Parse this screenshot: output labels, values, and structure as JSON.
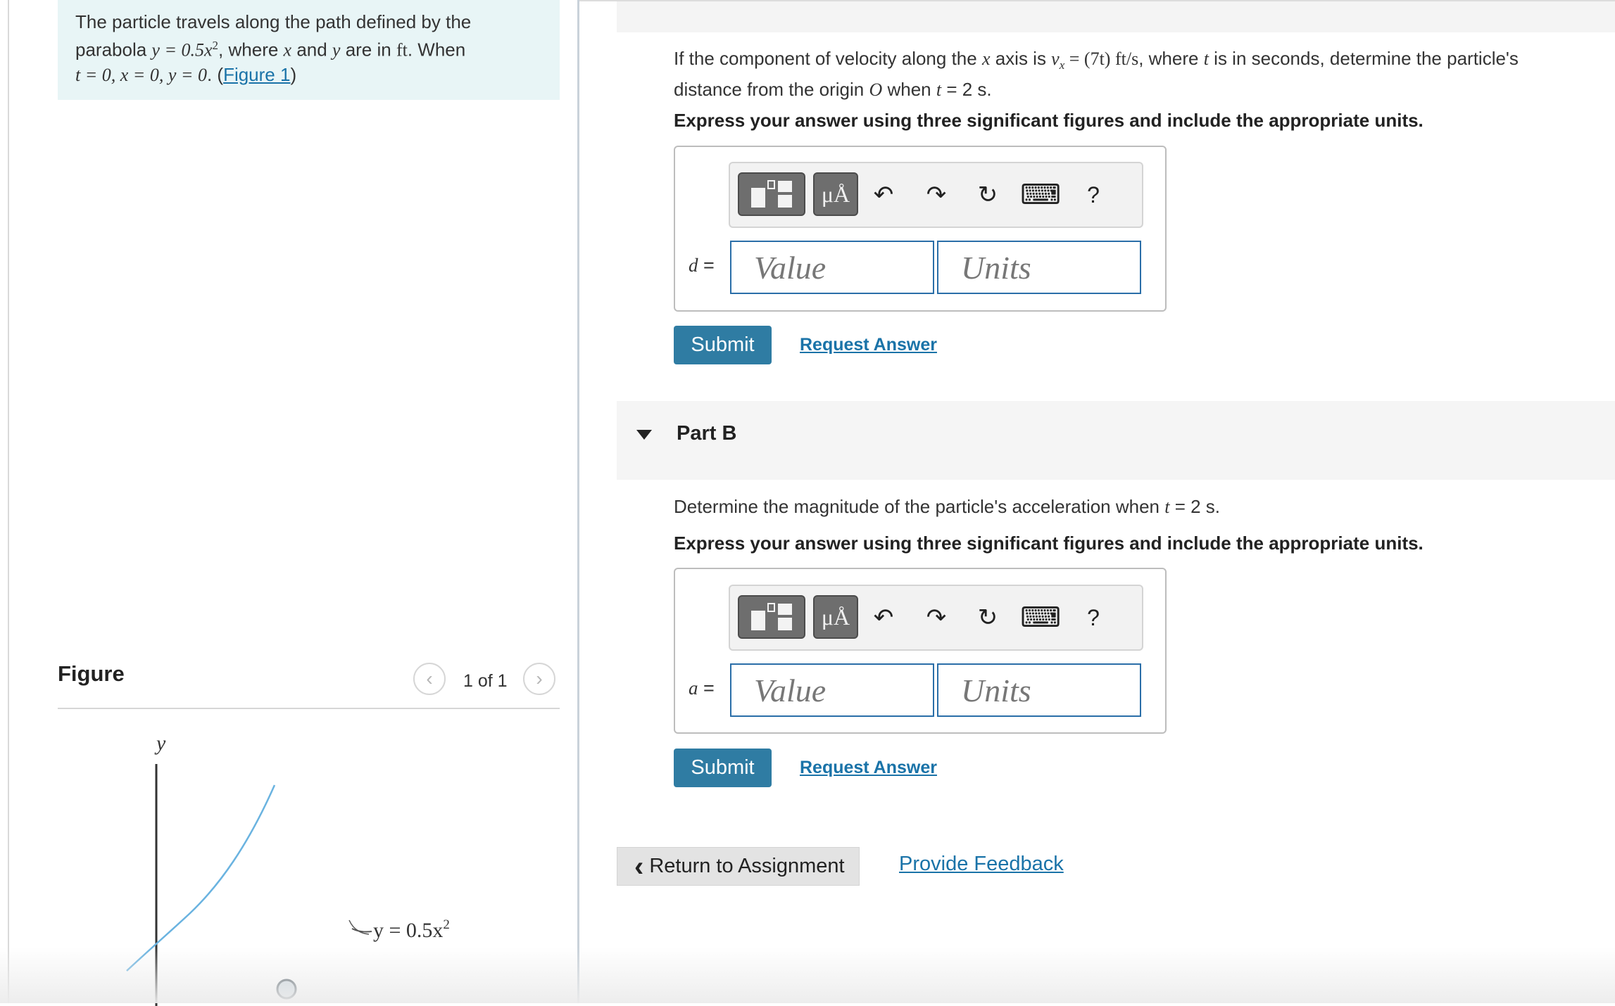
{
  "intro": {
    "line1": "The particle travels along the path defined by the",
    "line2_a": "parabola ",
    "line2_eq": "y = 0.5x",
    "line2_sup": "2",
    "line2_b": ", where ",
    "line2_x": "x",
    "line2_c": " and ",
    "line2_y": "y",
    "line2_d": " are in ",
    "line2_unit": "ft",
    "line2_e": ". When",
    "line3_eq": "t = 0, x = 0, y = 0",
    "line3_a": ". (",
    "figure_link": "Figure 1",
    "line3_b": ")"
  },
  "figure": {
    "title": "Figure",
    "counter": "1 of 1",
    "prev_glyph": "‹",
    "next_glyph": "›",
    "axis_y_label": "y",
    "curve_label": "y = 0.5x",
    "curve_label_sup": "2"
  },
  "partA": {
    "q_a": "If the component of velocity along the ",
    "q_x": "x",
    "q_b": " axis is ",
    "q_vx": "v",
    "q_vx_sub": "x",
    "q_c": " = (7t)  ft/s",
    "q_d": ", where ",
    "q_t": "t",
    "q_e": " is in seconds, determine the particle's",
    "q_line2_a": "distance from the origin ",
    "q_O": "O",
    "q_line2_b": " when ",
    "q_t2": "t",
    "q_line2_c": " = 2 s.",
    "instruction": "Express your answer using three significant figures and include the appropriate units.",
    "var": "d",
    "var_eq": " =",
    "value_placeholder": "Value",
    "units_placeholder": "Units",
    "submit": "Submit",
    "request": "Request Answer"
  },
  "toolbar": {
    "mu_label": "μÅ",
    "undo_glyph": "↶",
    "redo_glyph": "↷",
    "reset_glyph": "↻",
    "keyboard_glyph": "⌨",
    "help_glyph": "?"
  },
  "partB": {
    "title": "Part B",
    "q_a": "Determine the magnitude of the particle's acceleration when ",
    "q_t": "t",
    "q_b": " = 2 s.",
    "instruction": "Express your answer using three significant figures and include the appropriate units.",
    "var": "a",
    "var_eq": " =",
    "value_placeholder": "Value",
    "units_placeholder": "Units",
    "submit": "Submit",
    "request": "Request Answer"
  },
  "footer": {
    "return_glyph": "‹",
    "return_label": "Return to Assignment",
    "feedback": "Provide Feedback"
  }
}
